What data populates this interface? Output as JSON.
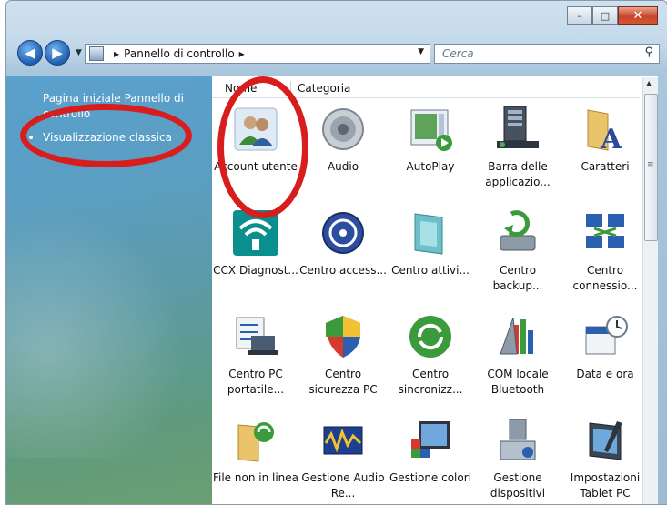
{
  "window": {
    "minimize": "–",
    "maximize": "□",
    "close": "✕"
  },
  "address": {
    "location": "Pannello di controllo",
    "back_icon": "back-arrow-icon",
    "forward_icon": "forward-arrow-icon"
  },
  "search": {
    "placeholder": "Cerca"
  },
  "sidebar": {
    "home_link": "Pagina iniziale Pannello di controllo",
    "classic_view": "Visualizzazione classica"
  },
  "columns": {
    "name": "Nome",
    "category": "Categoria"
  },
  "items": [
    {
      "label": "Account utente",
      "icon": "users-icon"
    },
    {
      "label": "Audio",
      "icon": "speaker-icon"
    },
    {
      "label": "AutoPlay",
      "icon": "autoplay-icon"
    },
    {
      "label": "Barra delle applicazio...",
      "icon": "taskbar-icon"
    },
    {
      "label": "Caratteri",
      "icon": "fonts-folder-icon"
    },
    {
      "label": "CCX Diagnost...",
      "icon": "wifi-icon"
    },
    {
      "label": "Centro access...",
      "icon": "accessibility-icon"
    },
    {
      "label": "Centro attivi...",
      "icon": "activity-center-icon"
    },
    {
      "label": "Centro backup...",
      "icon": "backup-icon"
    },
    {
      "label": "Centro connessio...",
      "icon": "network-icon"
    },
    {
      "label": "Centro PC portatile...",
      "icon": "laptop-icon"
    },
    {
      "label": "Centro sicurezza PC",
      "icon": "security-shield-icon"
    },
    {
      "label": "Centro sincronizz...",
      "icon": "sync-icon"
    },
    {
      "label": "COM locale Bluetooth",
      "icon": "bluetooth-icon"
    },
    {
      "label": "Data e ora",
      "icon": "calendar-clock-icon"
    },
    {
      "label": "File non in linea",
      "icon": "offline-files-icon"
    },
    {
      "label": "Gestione Audio Re...",
      "icon": "audio-manager-icon"
    },
    {
      "label": "Gestione colori",
      "icon": "color-management-icon"
    },
    {
      "label": "Gestione dispositivi",
      "icon": "device-manager-icon"
    },
    {
      "label": "Impostazioni Tablet PC",
      "icon": "tablet-icon"
    }
  ],
  "colors": {
    "annotation_ring": "#d81d1d"
  }
}
